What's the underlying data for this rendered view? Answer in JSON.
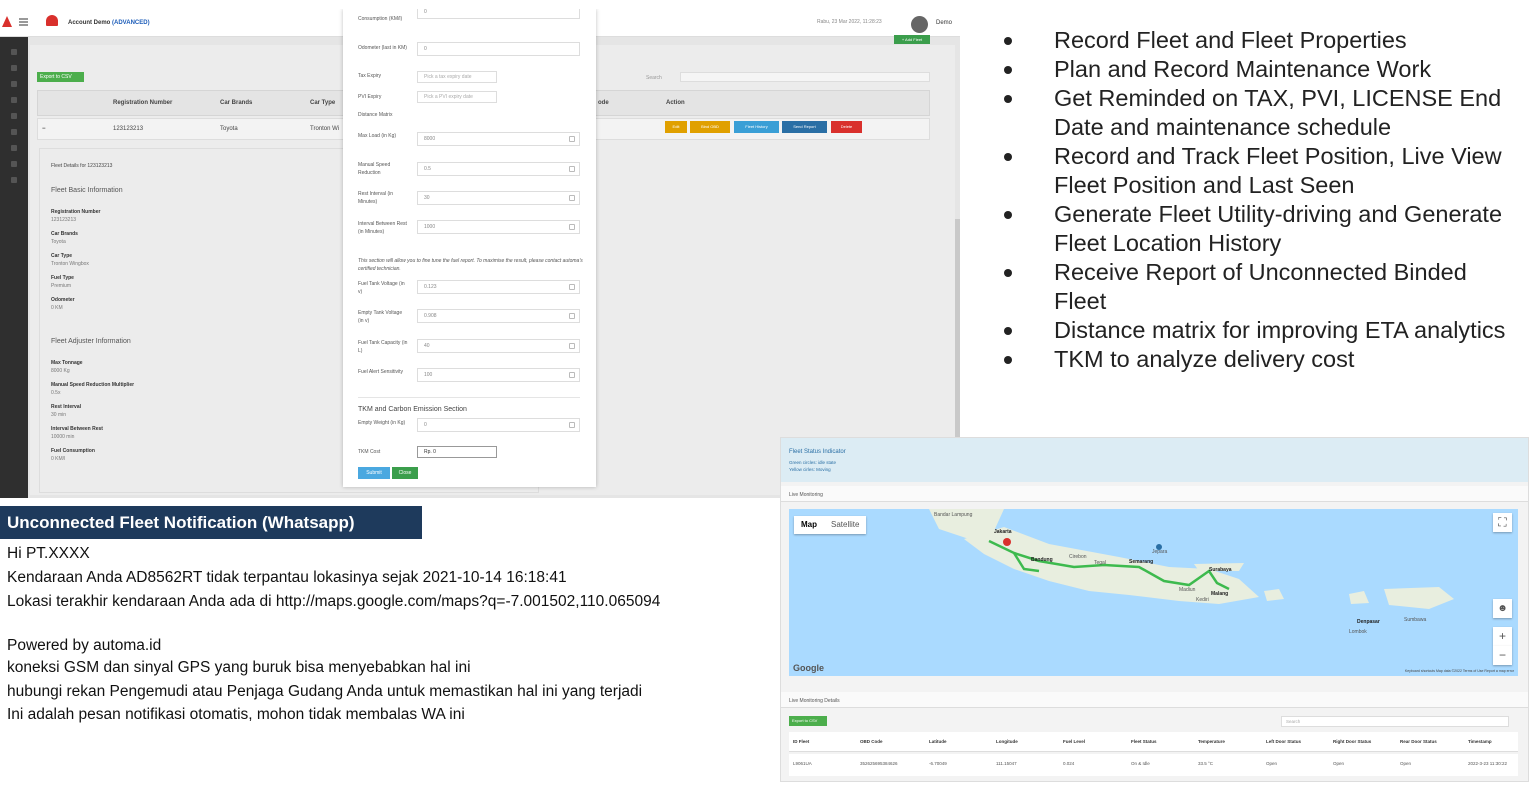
{
  "admin": {
    "account_label": "Account Demo",
    "account_tag": "(ADVANCED)",
    "date": "Rabu, 23 Mar 2022, 11:28:23",
    "user": "Demo",
    "add_fleet": "+ Add Fleet",
    "export_csv": "Export to CSV",
    "search_label": "Search",
    "table_headers": [
      "Registration Number",
      "Car Brands",
      "Car Type",
      "ode",
      "Action"
    ],
    "row": {
      "toggle": "−",
      "reg": "123123213",
      "brand": "Toyota",
      "type": "Tronton Wi"
    },
    "actions": [
      "Edit",
      "Bind OBD",
      "Fleet History",
      "Send Report",
      "Delete"
    ],
    "details_title": "Fleet Details for 123123213",
    "basic_heading": "Fleet Basic Information",
    "basic": [
      {
        "label": "Registration Number",
        "value": "123123213"
      },
      {
        "label": "Car Brands",
        "value": "Toyota"
      },
      {
        "label": "Car Type",
        "value": "Tronton Wingbox"
      },
      {
        "label": "Fuel Type",
        "value": "Premium"
      },
      {
        "label": "Odometer",
        "value": "0 KM"
      }
    ],
    "adjuster_heading": "Fleet Adjuster Information",
    "adjuster": [
      {
        "label": "Max Tonnage",
        "value": "8000 Kg"
      },
      {
        "label": "Manual Speed Reduction Multiplier",
        "value": "0.5x"
      },
      {
        "label": "Rest Interval",
        "value": "30 min"
      },
      {
        "label": "Interval Between Rest",
        "value": "10000 min"
      },
      {
        "label": "Fuel Consumption",
        "value": "0 KM/l"
      }
    ]
  },
  "modal": {
    "fuel_consumption_label": "Consumption (KM/l)",
    "fuel_consumption_value": "0",
    "odometer_label": "Odometer (last in KM)",
    "odometer_value": "0",
    "tax_label": "Tax Expiry",
    "tax_placeholder": "Pick a tax expiry date",
    "pvi_label": "PVI Expiry",
    "pvi_placeholder": "Pick a PVI expiry date",
    "distance_matrix": "Distance Matrix",
    "fields": [
      {
        "label": "Max Load (in Kg)",
        "value": "8000"
      },
      {
        "label": "Manual Speed Reduction",
        "value": "0.5"
      },
      {
        "label": "Rest Interval (in Minutes)",
        "value": "30"
      },
      {
        "label": "Interval Between Rest (in Minutes)",
        "value": "1000"
      }
    ],
    "note": "This section will allow you to fine tune the fuel report. To maximise the result, please contact automa's certified technician.",
    "fuel_fields": [
      {
        "label": "Fuel Tank Voltage (in v)",
        "value": "0.123"
      },
      {
        "label": "Empty Tank Voltage (in v)",
        "value": "0.908"
      },
      {
        "label": "Fuel Tank Capacity (in L)",
        "value": "40"
      },
      {
        "label": "Fuel Alert Sensitivity",
        "value": "100"
      }
    ],
    "tkm_heading": "TKM and Carbon Emission Section",
    "empty_weight_label": "Empty Weight (in Kg)",
    "empty_weight_value": "0",
    "tkm_cost_label": "TKM Cost",
    "tkm_cost_value": "Rp. 0",
    "submit": "Submit",
    "close": "Close"
  },
  "features": [
    "Record Fleet and Fleet Properties",
    "Plan and Record Maintenance Work",
    "Get Reminded on TAX, PVI, LICENSE End Date and maintenance schedule",
    "Record and Track Fleet Position, Live View Fleet Position and Last Seen",
    "Generate Fleet Utility-driving and Generate Fleet Location History",
    "Receive Report of Unconnected Binded Fleet",
    "Distance matrix for improving ETA analytics",
    "TKM to analyze delivery cost"
  ],
  "notification": {
    "title": "Unconnected Fleet Notification (Whatsapp)",
    "greeting": "Hi  PT.XXXX",
    "line1": "Kendaraan Anda  AD8562RT  tidak terpantau lokasinya sejak 2021-10-14 16:18:41",
    "line2": "Lokasi terakhir kendaraan Anda ada di http://maps.google.com/maps?q=-7.001502,110.065094",
    "line3": "Powered by automa.id",
    "line4": "koneksi GSM dan sinyal GPS yang buruk bisa menyebabkan hal ini",
    "line5": "hubungi rekan Pengemudi atau Penjaga Gudang Anda untuk memastikan hal ini yang terjadi",
    "line6": "Ini adalah pesan notifikasi otomatis, mohon tidak membalas WA ini"
  },
  "monitor": {
    "status_title": "Fleet Status Indicator",
    "green_note": "Green circles: idle state",
    "yellow_note": "Yellow cirles: Moving",
    "live_monitoring": "Live Monitoring",
    "map_tab": "Map",
    "satellite_tab": "Satellite",
    "google": "Google",
    "map_footer": "Keyboard shortcuts   Map data ©2022   Terms of Use   Report a map error",
    "cities": [
      "Jakarta",
      "Bandung",
      "Semarang",
      "Surabaya",
      "Malang",
      "Denpasar",
      "Cirebon",
      "Tegal",
      "Jepara",
      "Madiun",
      "Kediri",
      "Lombok",
      "Sumbawa",
      "Bandar Lampung"
    ],
    "details_label": "Live Monitoring Details",
    "export_csv": "Export to CSV",
    "search_placeholder": "Search",
    "headers": [
      "ID Fleet",
      "OBD Code",
      "Latitude",
      "Longitude",
      "Fuel Level",
      "Fleet Status",
      "Temperature",
      "Left Door Status",
      "Right Door Status",
      "Rear Door Status",
      "Timestamp"
    ],
    "row": [
      "L9061UA",
      "352625695384626",
      "-6.70049",
      "111.15047",
      "0.024",
      "On & Idle",
      "33.5 °C",
      "Open",
      "Open",
      "Open",
      "2022-3-23 11:30:22"
    ]
  }
}
